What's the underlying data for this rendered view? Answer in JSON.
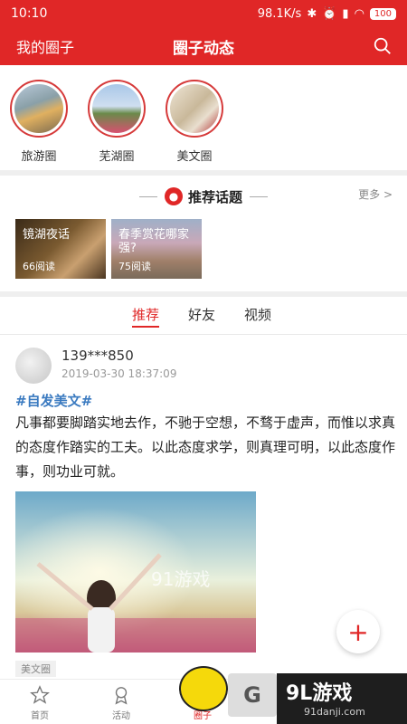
{
  "status": {
    "time": "10:10",
    "speed": "98.1K/s",
    "battery": "100"
  },
  "nav": {
    "left": "我的圈子",
    "title": "圈子动态"
  },
  "circles": [
    {
      "label": "旅游圈"
    },
    {
      "label": "芜湖圈"
    },
    {
      "label": "美文圈"
    }
  ],
  "topics": {
    "title": "推荐话题",
    "more": "更多 >",
    "cards": [
      {
        "title": "镜湖夜话",
        "reads": "66阅读"
      },
      {
        "title": "春季赏花哪家强?",
        "reads": "75阅读"
      }
    ]
  },
  "tabs": [
    "推荐",
    "好友",
    "视频"
  ],
  "post": {
    "user": "139***850",
    "time": "2019-03-30 18:37:09",
    "tag": "#自发美文#",
    "body": "凡事都要脚踏实地去作，不驰于空想，不骛于虚声，而惟以求真的态度作踏实的工夫。以此态度求学，则真理可明，以此态度作事，则功业可就。",
    "circle": "美文圈",
    "watermark": "91游戏"
  },
  "tabbar": [
    {
      "label": "首页",
      "icon": "star-icon"
    },
    {
      "label": "活动",
      "icon": "award-icon"
    },
    {
      "label": "圈子",
      "icon": "circle-icon"
    }
  ],
  "ad": {
    "brand": "9L游戏",
    "url": "91danji.com"
  },
  "colors": {
    "brand": "#e02727",
    "link": "#3a7ac0"
  }
}
